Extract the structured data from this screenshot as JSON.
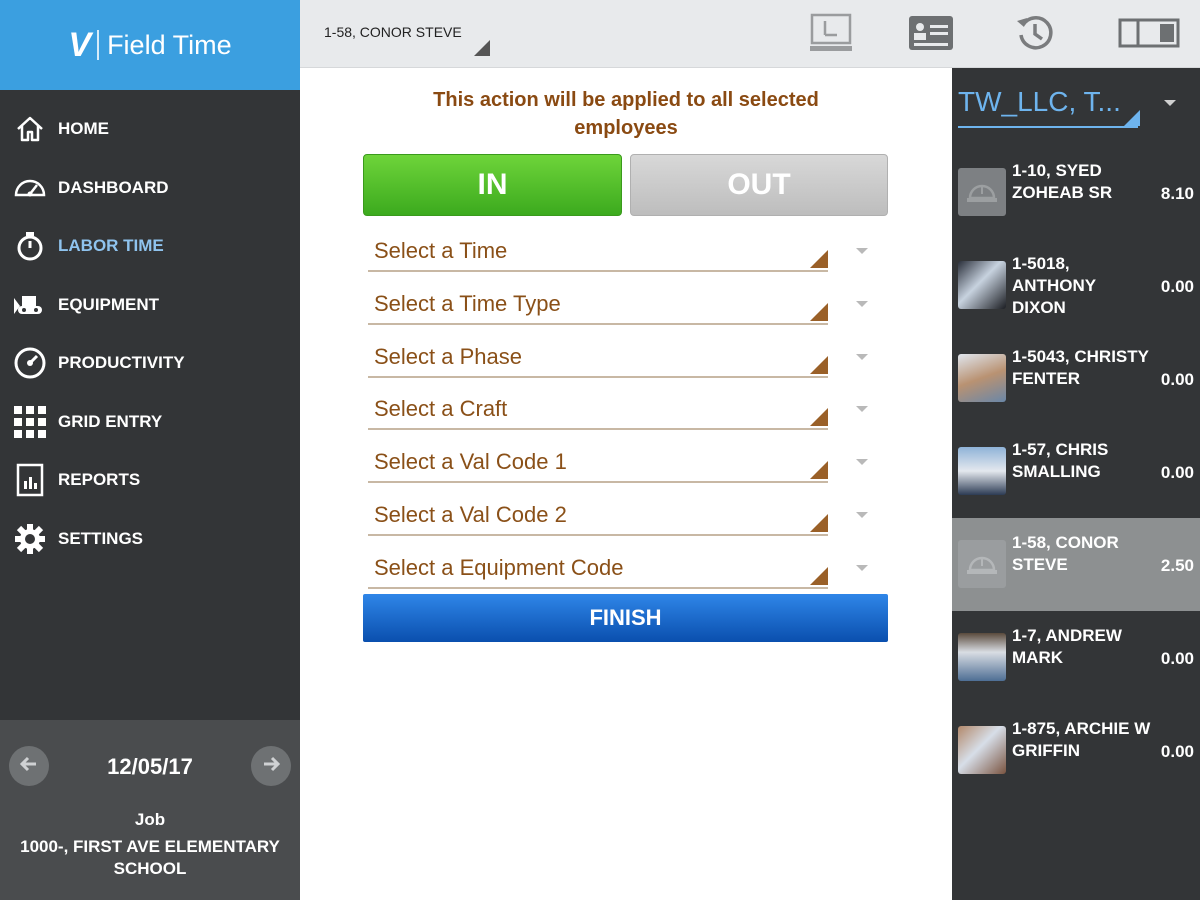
{
  "brand": {
    "logo": "V",
    "name": "Field Time"
  },
  "nav": [
    {
      "label": "HOME",
      "icon": "home-icon",
      "active": false
    },
    {
      "label": "DASHBOARD",
      "icon": "speedometer-icon",
      "active": false
    },
    {
      "label": "LABOR TIME",
      "icon": "stopwatch-icon",
      "active": true
    },
    {
      "label": "EQUIPMENT",
      "icon": "bulldozer-icon",
      "active": false
    },
    {
      "label": "PRODUCTIVITY",
      "icon": "gauge-icon",
      "active": false
    },
    {
      "label": "GRID ENTRY",
      "icon": "grid-icon",
      "active": false
    },
    {
      "label": "REPORTS",
      "icon": "report-icon",
      "active": false
    },
    {
      "label": "SETTINGS",
      "icon": "gear-icon",
      "active": false
    }
  ],
  "date_panel": {
    "date": "12/05/17",
    "job_label": "Job",
    "job_name": "1000-, FIRST AVE ELEMENTARY SCHOOL"
  },
  "topbar": {
    "employee": "1-58, CONOR STEVE",
    "icons": [
      "timesheet-icon",
      "id-card-icon",
      "history-icon",
      "toggle-view-icon"
    ]
  },
  "main": {
    "notice": "This action will be applied to all selected employees",
    "in_label": "IN",
    "out_label": "OUT",
    "fields": [
      "Select a Time",
      "Select a Time Type",
      "Select a Phase",
      "Select a Craft",
      "Select a Val Code 1",
      "Select a Val Code 2",
      "Select a Equipment Code"
    ],
    "finish_label": "FINISH"
  },
  "right_panel": {
    "company": "TW_LLC, T...",
    "employees": [
      {
        "name": "1-10, SYED ZOHEAB SR",
        "hours": "8.10",
        "selected": false,
        "photo": false
      },
      {
        "name": "1-5018, ANTHONY DIXON",
        "hours": "0.00",
        "selected": false,
        "photo": true
      },
      {
        "name": "1-5043, CHRISTY FENTER",
        "hours": "0.00",
        "selected": false,
        "photo": true
      },
      {
        "name": "1-57, CHRIS SMALLING",
        "hours": "0.00",
        "selected": false,
        "photo": true
      },
      {
        "name": "1-58, CONOR STEVE",
        "hours": "2.50",
        "selected": true,
        "photo": false
      },
      {
        "name": "1-7, ANDREW MARK",
        "hours": "0.00",
        "selected": false,
        "photo": true
      },
      {
        "name": "1-875, ARCHIE W GRIFFIN",
        "hours": "0.00",
        "selected": false,
        "photo": true
      }
    ]
  },
  "colors": {
    "sidebar": "#333537",
    "brand_blue": "#3b9fe0",
    "active_nav": "#8fc3ee",
    "in_green": "#4cbf28",
    "out_gray": "#c4c4c4",
    "finish_blue": "#1a63c6",
    "field_text": "#8a5018"
  }
}
